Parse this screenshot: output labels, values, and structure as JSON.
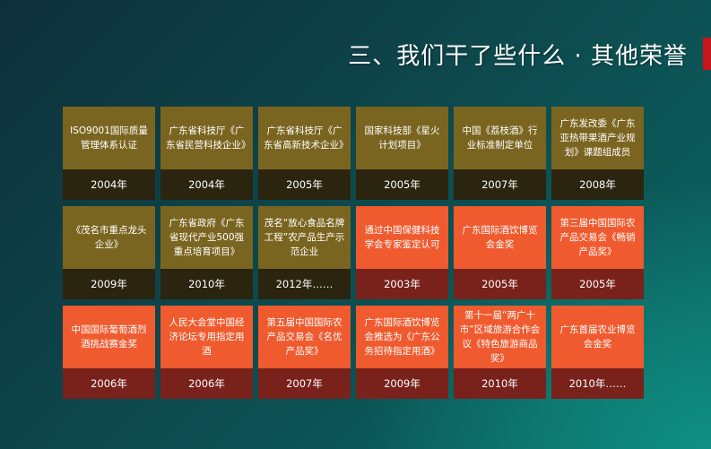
{
  "title": "三、我们干了些什么 · 其他荣誉",
  "colors": {
    "olive": "#7a6520",
    "olive_dark": "#2b2510",
    "orange": "#ef5a2e",
    "orange_dark": "#79211b",
    "accent_red": "#c8141c"
  },
  "awards": [
    {
      "text": "ISO9001国际质量管理体系认证",
      "year": "2004年",
      "style": "olive"
    },
    {
      "text": "广东省科技厅《广东省民营科技企业》",
      "year": "2004年",
      "style": "olive"
    },
    {
      "text": "广东省科技厅《广东省高新技术企业》",
      "year": "2005年",
      "style": "olive"
    },
    {
      "text": "国家科技部《星火计划项目》",
      "year": "2005年",
      "style": "olive"
    },
    {
      "text": "中国《荔枝酒》行业标准制定单位",
      "year": "2007年",
      "style": "olive"
    },
    {
      "text": "广东发改委《广东亚热带果酒产业规划》课题组成员",
      "year": "2008年",
      "style": "olive"
    },
    {
      "text": "《茂名市重点龙头企业》",
      "year": "2009年",
      "style": "olive"
    },
    {
      "text": "广东省政府《广东省现代产业500强重点培育项目》",
      "year": "2010年",
      "style": "olive"
    },
    {
      "text": "茂名“放心食品名牌工程”农产品生产示范企业",
      "year": "2012年……",
      "style": "olive"
    },
    {
      "text": "通过中国保健科技学会专家鉴定认可",
      "year": "2003年",
      "style": "orange"
    },
    {
      "text": "广东国际酒饮博览会金奖",
      "year": "2005年",
      "style": "orange"
    },
    {
      "text": "第三届中国国际农产品交易会《畅销产品奖》",
      "year": "2005年",
      "style": "orange"
    },
    {
      "text": "中国国际葡萄酒烈酒挑战赛金奖",
      "year": "2006年",
      "style": "orange"
    },
    {
      "text": "人民大会堂中国经济论坛专用指定用酒",
      "year": "2006年",
      "style": "orange"
    },
    {
      "text": "第五届中国国际农产品交易会《名优产品奖》",
      "year": "2007年",
      "style": "orange"
    },
    {
      "text": "广东国际酒饮博览会推选为《广东公务招待指定用酒》",
      "year": "2009年",
      "style": "orange"
    },
    {
      "text": "第十一届“两广十市”区域旅游合作会议《特色旅游商品奖》",
      "year": "2010年",
      "style": "orange"
    },
    {
      "text": "广东首届农业博览会金奖",
      "year": "2010年……",
      "style": "orange"
    }
  ]
}
